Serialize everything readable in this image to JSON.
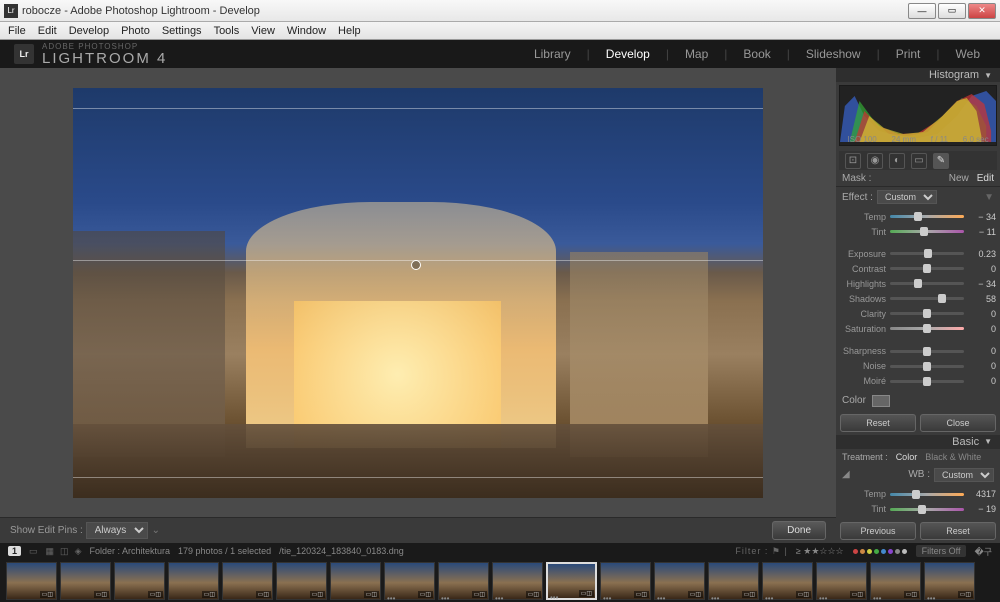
{
  "window": {
    "title": "robocze - Adobe Photoshop Lightroom - Develop"
  },
  "menu": [
    "File",
    "Edit",
    "Develop",
    "Photo",
    "Settings",
    "Tools",
    "View",
    "Window",
    "Help"
  ],
  "brand": {
    "small": "ADOBE PHOTOSHOP",
    "big": "LIGHTROOM 4"
  },
  "modules": [
    "Library",
    "Develop",
    "Map",
    "Book",
    "Slideshow",
    "Print",
    "Web"
  ],
  "active_module": "Develop",
  "toolbar": {
    "pins_label": "Show Edit Pins :",
    "pins_value": "Always",
    "done": "Done"
  },
  "panels": {
    "histogram": {
      "title": "Histogram",
      "meta": [
        "ISO 100",
        "24 mm",
        "f / 11",
        "6.0 sec"
      ]
    },
    "mask": {
      "label": "Mask :",
      "new": "New",
      "edit": "Edit"
    },
    "effect": {
      "label": "Effect :",
      "value": "Custom"
    },
    "sliders1": [
      {
        "name": "Temp",
        "val": "− 34",
        "pos": 38,
        "cls": "temp"
      },
      {
        "name": "Tint",
        "val": "− 11",
        "pos": 46,
        "cls": "tint"
      }
    ],
    "sliders2": [
      {
        "name": "Exposure",
        "val": "0.23",
        "pos": 52
      },
      {
        "name": "Contrast",
        "val": "0",
        "pos": 50
      },
      {
        "name": "Highlights",
        "val": "− 34",
        "pos": 38
      },
      {
        "name": "Shadows",
        "val": "58",
        "pos": 70
      },
      {
        "name": "Clarity",
        "val": "0",
        "pos": 50
      },
      {
        "name": "Saturation",
        "val": "0",
        "pos": 50,
        "cls": "sat"
      }
    ],
    "sliders3": [
      {
        "name": "Sharpness",
        "val": "0",
        "pos": 50
      },
      {
        "name": "Noise",
        "val": "0",
        "pos": 50
      },
      {
        "name": "Moiré",
        "val": "0",
        "pos": 50
      }
    ],
    "color_label": "Color",
    "reset": "Reset",
    "close": "Close",
    "basic": {
      "title": "Basic",
      "treatment": "Treatment :",
      "color": "Color",
      "bw": "Black & White",
      "wb": "WB :",
      "wb_val": "Custom"
    },
    "basic_sliders": [
      {
        "name": "Temp",
        "val": "4317",
        "pos": 35,
        "cls": "temp"
      },
      {
        "name": "Tint",
        "val": "− 19",
        "pos": 43,
        "cls": "tint"
      }
    ],
    "previous": "Previous",
    "reset2": "Reset"
  },
  "secondary": {
    "badge": "1",
    "folder_label": "Folder : Architektura",
    "count": "179 photos / 1 selected",
    "filename": "/tie_120324_183840_0183.dng",
    "filter": "Filter :",
    "filters_off": "Filters Off"
  },
  "dot_colors": [
    "#c44",
    "#c84",
    "#cc4",
    "#4a4",
    "#48c",
    "#84c",
    "#888",
    "#bbb"
  ],
  "thumbs": 18,
  "selected_thumb": 10
}
